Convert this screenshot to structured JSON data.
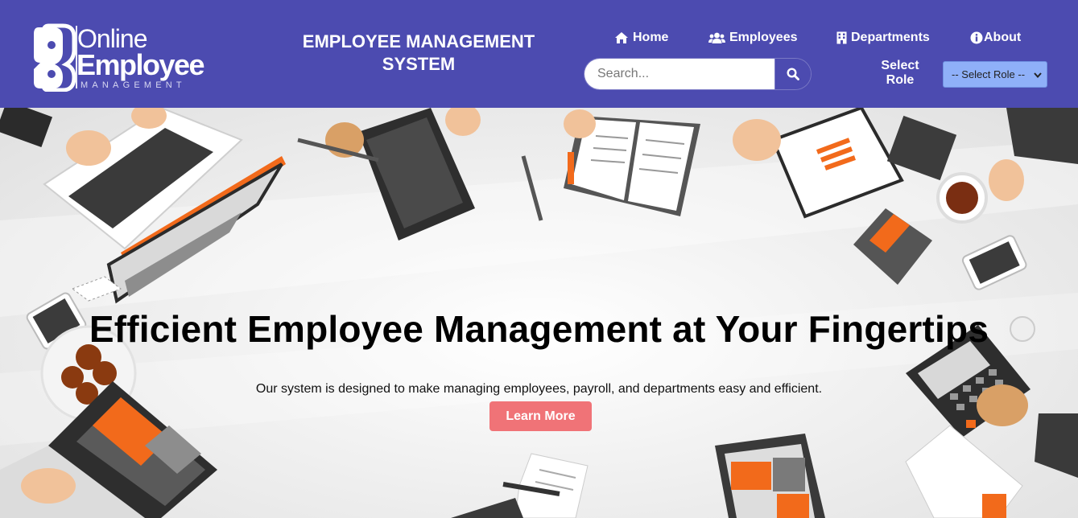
{
  "logo": {
    "line1": "Online",
    "line2": "Employee",
    "line3": "MANAGEMENT"
  },
  "header": {
    "title": "EMPLOYEE MANAGEMENT SYSTEM"
  },
  "nav": [
    {
      "label": "Home",
      "icon": "home-icon"
    },
    {
      "label": "Employees",
      "icon": "users-icon"
    },
    {
      "label": "Departments",
      "icon": "building-icon"
    },
    {
      "label": "About",
      "icon": "info-icon"
    }
  ],
  "search": {
    "placeholder": "Search...",
    "value": "",
    "button_icon": "search-icon"
  },
  "role": {
    "label": "Select Role",
    "selected": "-- Select Role --"
  },
  "hero": {
    "title": "Efficient Employee Management at Your Fingertips",
    "subtitle": "Our system is designed to make managing employees, payroll, and departments easy and efficient.",
    "cta_label": "Learn More"
  },
  "colors": {
    "header_bg": "#4c4bb0",
    "cta_bg": "#f07377",
    "select_bg": "#8fb0f8",
    "illustration_accent": "#f26a1b"
  }
}
